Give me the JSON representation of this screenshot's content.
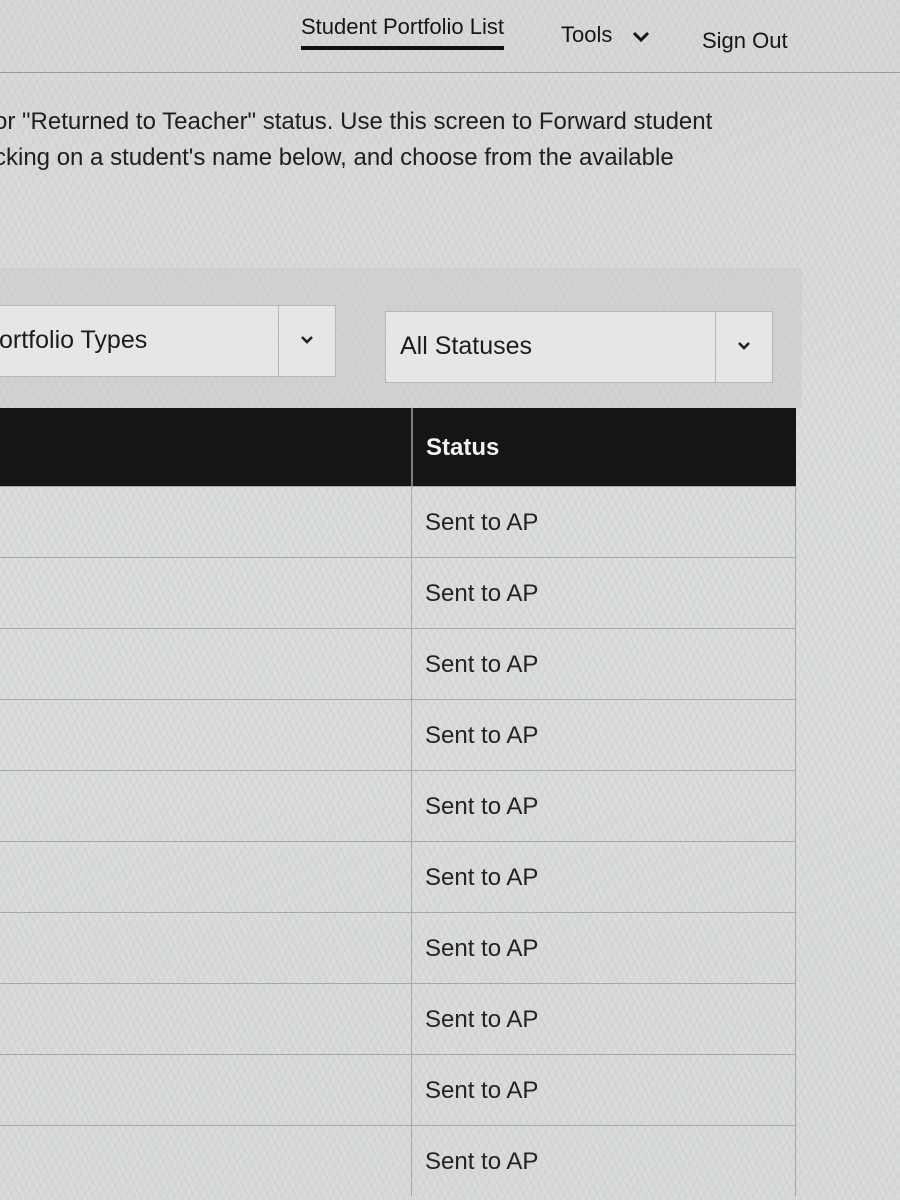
{
  "nav": {
    "portfolio_list": "Student Portfolio List",
    "tools": "Tools",
    "sign_out": "Sign Out"
  },
  "intro": {
    "line1": "or \"Returned to Teacher\" status. Use this screen to Forward student",
    "line2": "cking on a student's name below, and choose from the available"
  },
  "filters": {
    "portfolio_type_value": "ortfolio Types",
    "status_value": "All Statuses"
  },
  "table": {
    "status_header": "Status",
    "rows": [
      {
        "status": "Sent to AP"
      },
      {
        "status": "Sent to AP"
      },
      {
        "status": "Sent to AP"
      },
      {
        "status": "Sent to AP"
      },
      {
        "status": "Sent to AP"
      },
      {
        "status": "Sent to AP"
      },
      {
        "status": "Sent to AP"
      },
      {
        "status": "Sent to AP"
      },
      {
        "status": "Sent to AP"
      },
      {
        "status": "Sent to AP"
      }
    ]
  },
  "icons": {
    "tools_dropdown": "chevron-down-icon",
    "select_dropdown": "chevron-down-icon"
  },
  "colors": {
    "header_bg": "#151515",
    "header_text": "#f2f2f2",
    "active_underline": "#111111"
  }
}
